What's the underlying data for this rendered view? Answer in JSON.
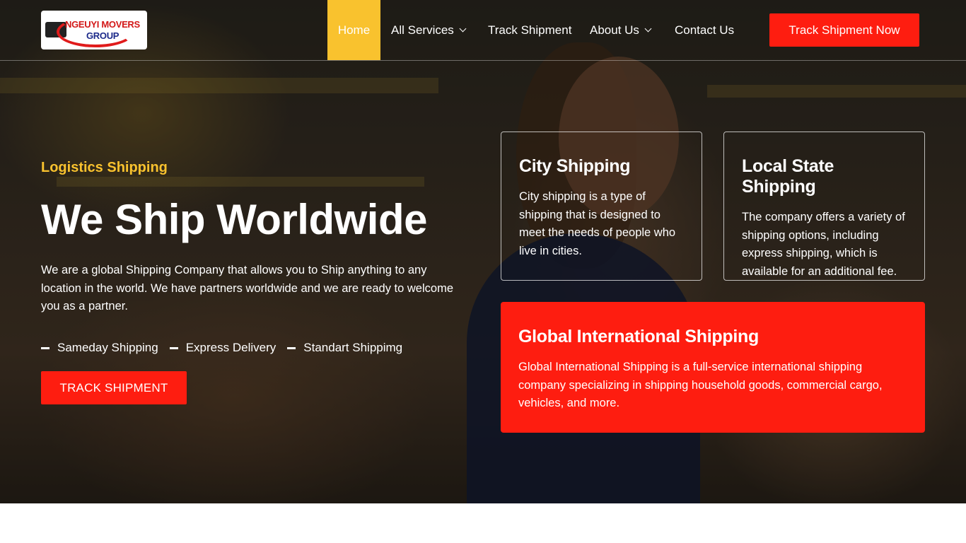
{
  "brand": {
    "logo_line1": "NGEUYI MOVERS",
    "logo_line2": "GROUP"
  },
  "nav": {
    "items": [
      {
        "label": "Home",
        "active": true
      },
      {
        "label": "All Services",
        "dropdown": true
      },
      {
        "label": "Track Shipment"
      },
      {
        "label": "About Us",
        "dropdown": true
      },
      {
        "label": "Contact Us"
      }
    ],
    "cta_label": "Track Shipment Now"
  },
  "hero": {
    "tagline": "Logistics Shipping",
    "headline": "We Ship Worldwide",
    "description": "We are a global Shipping Company that allows you to Ship anything to any location in the world. We have partners worldwide and we are ready to welcome you as a partner.",
    "features": [
      "Sameday Shipping",
      "Express Delivery",
      "Standart Shippimg"
    ],
    "cta_label": "TRACK SHIPMENT"
  },
  "cards": [
    {
      "title": "City Shipping",
      "text": "City shipping is a type of shipping that is designed to meet the needs of people who live in cities."
    },
    {
      "title": "Local State Shipping",
      "text": "The company offers a variety of shipping options, including express shipping, which is available for an additional fee."
    },
    {
      "title": "Global International Shipping",
      "text": "Global International Shipping is a full-service international shipping company specializing in shipping household goods, commercial cargo, vehicles, and more."
    }
  ],
  "colors": {
    "accent_yellow": "#f9c22e",
    "accent_red": "#fe1d10",
    "text_light": "#ffffff"
  },
  "icons": {
    "logo": "truck-logo-icon",
    "dropdown": "chevron-down-icon",
    "feature_bullet": "dash-icon"
  }
}
